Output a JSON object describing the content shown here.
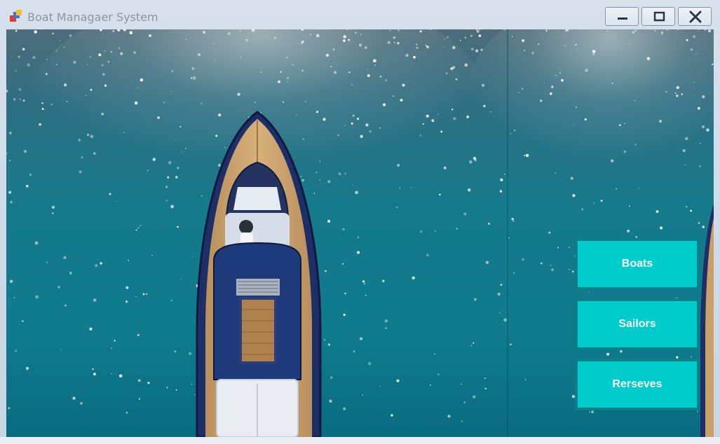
{
  "window": {
    "title": "Boat Managaer System"
  },
  "titlebar_buttons": [
    {
      "name": "minimize-button",
      "icon": "minimize-icon"
    },
    {
      "name": "maximize-button",
      "icon": "maximize-icon"
    },
    {
      "name": "close-button",
      "icon": "close-icon"
    }
  ],
  "menu": {
    "boats_label": "Boats",
    "sailors_label": "Sailors",
    "reserves_label": "Rerseves"
  },
  "colors": {
    "button_fill": "#00cccc",
    "button_border": "#0b7f86",
    "water": "#0c5a70"
  }
}
